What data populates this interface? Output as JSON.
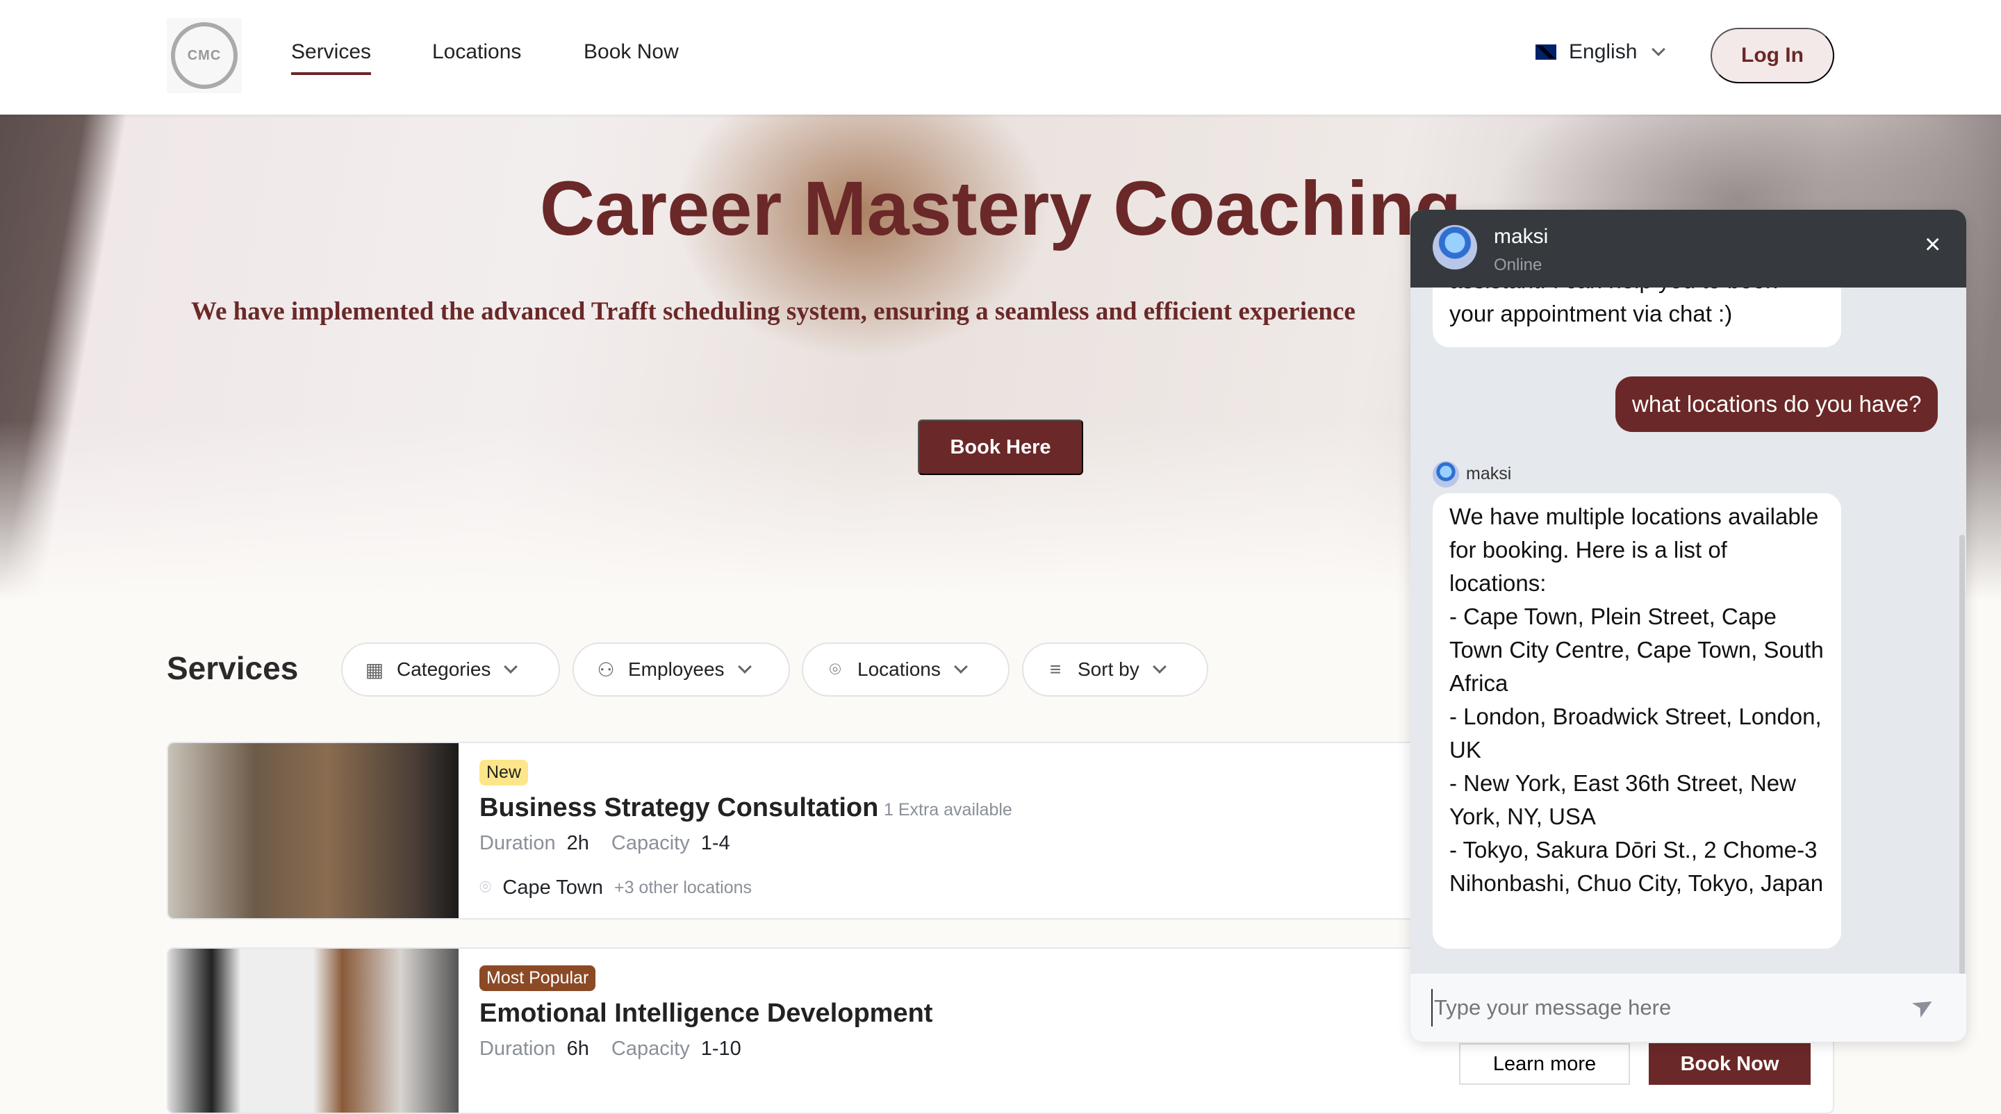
{
  "header": {
    "logo_text": "CMC",
    "nav": [
      "Services",
      "Locations",
      "Book Now"
    ],
    "active_nav": "Services",
    "language": "English",
    "login": "Log In"
  },
  "hero": {
    "title": "Career Mastery Coaching",
    "subtitle": "We have implemented the advanced Trafft scheduling system, ensuring a seamless and efficient experience",
    "button": "Book Here"
  },
  "services": {
    "heading": "Services",
    "filters": [
      "Categories",
      "Employees",
      "Locations",
      "Sort by"
    ],
    "cards": [
      {
        "badge": "New",
        "badge_color": "#fde68a",
        "title": "Business Strategy Consultation",
        "extra": "1 Extra available",
        "duration_label": "Duration",
        "duration": "2h",
        "capacity_label": "Capacity",
        "capacity": "1-4",
        "location": "Cape Town",
        "other_locations": "+3 other locations"
      },
      {
        "badge": "Most Popular",
        "badge_color": "#8b4a26",
        "title": "Emotional Intelligence Development",
        "duration_label": "Duration",
        "duration": "6h",
        "capacity_label": "Capacity",
        "capacity": "1-10"
      }
    ],
    "learn_more": "Learn more",
    "book_now": "Book Now"
  },
  "chat": {
    "bot_name": "maksi",
    "status": "Online",
    "messages": [
      {
        "from": "bot",
        "text": "assistant. I can help you to book your appointment via chat :)"
      },
      {
        "from": "user",
        "text": "what locations do you have?"
      },
      {
        "from": "bot",
        "sender": "maksi",
        "text": "We have multiple locations available for booking. Here is a list of locations:\n- Cape Town, Plein Street, Cape Town City Centre, Cape Town, South Africa\n- London, Broadwick Street, London, UK\n- New York, East 36th Street, New York, NY, USA\n- Tokyo, Sakura Dōri St., 2 Chome-3 Nihonbashi, Chuo City, Tokyo, Japan"
      }
    ],
    "input_placeholder": "Type your message here"
  },
  "colors": {
    "brand": "#6b2828",
    "chat_header": "#363a3e"
  }
}
